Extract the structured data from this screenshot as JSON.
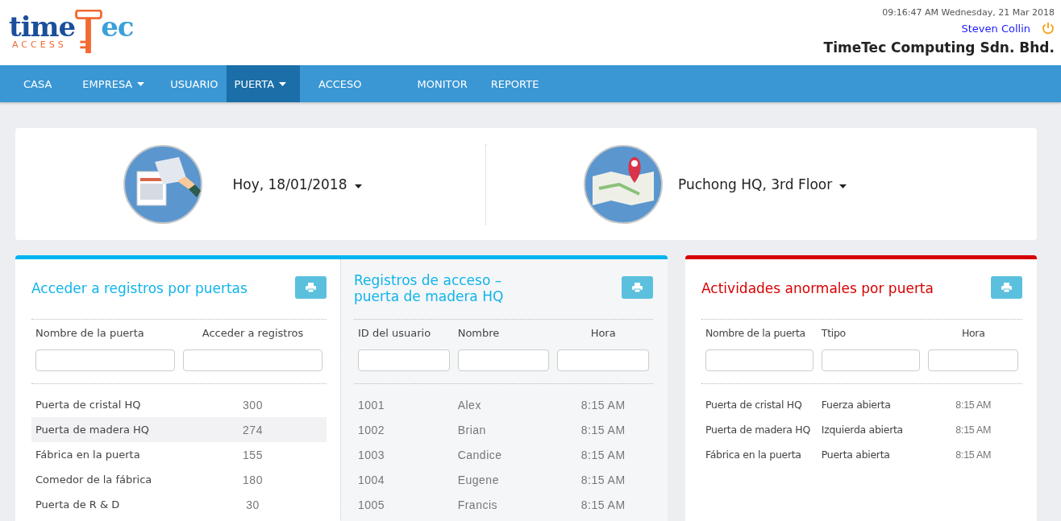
{
  "logo": {
    "word_left": "time",
    "word_right": "ec",
    "subtitle": "ACCESS"
  },
  "header": {
    "datetime": "09:16:47 AM Wednesday, 21 Mar 2018",
    "user": "Steven Collin",
    "company": "TimeTec Computing Sdn. Bhd."
  },
  "nav": [
    {
      "label": "CASA",
      "dropdown": false,
      "selected": false
    },
    {
      "label": "EMPRESA",
      "dropdown": true,
      "selected": false
    },
    {
      "label": "USUARIO",
      "dropdown": false,
      "selected": false
    },
    {
      "label": "PUERTA",
      "dropdown": true,
      "selected": true
    },
    {
      "label": "ACCESO",
      "dropdown": false,
      "selected": false
    },
    {
      "label": "MONITOR",
      "dropdown": false,
      "selected": false
    },
    {
      "label": "REPORTE",
      "dropdown": false,
      "selected": false
    }
  ],
  "filters": {
    "date": "Hoy, 18/01/2018",
    "location": "Puchong HQ, 3rd Floor"
  },
  "door_logs": {
    "title": "Acceder a registros por puertas",
    "columns": [
      "Nombre de la puerta",
      "Acceder a registros"
    ],
    "rows": [
      {
        "cells": [
          "Puerta de cristal HQ",
          "300"
        ],
        "selected": false
      },
      {
        "cells": [
          "Puerta de madera HQ",
          "274"
        ],
        "selected": true
      },
      {
        "cells": [
          "Fábrica en la puerta",
          "155"
        ],
        "selected": false
      },
      {
        "cells": [
          "Comedor de la fábrica",
          "180"
        ],
        "selected": false
      },
      {
        "cells": [
          "Puerta de R & D",
          "30"
        ],
        "selected": false
      }
    ]
  },
  "access_logs": {
    "title_line_1": "Registros de acceso –",
    "title_line_2": "puerta de madera HQ",
    "columns": [
      "ID del usuario",
      "Nombre",
      "Hora"
    ],
    "rows": [
      [
        "1001",
        "Alex",
        "8:15 AM"
      ],
      [
        "1002",
        "Brian",
        "8:15 AM"
      ],
      [
        "1003",
        "Candice",
        "8:15 AM"
      ],
      [
        "1004",
        "Eugene",
        "8:15 AM"
      ],
      [
        "1005",
        "Francis",
        "8:15 AM"
      ]
    ]
  },
  "abnormal": {
    "title": "Actividades anormales  por puerta",
    "columns": [
      "Nombre de la puerta",
      "Ttipo",
      "Hora"
    ],
    "rows": [
      [
        "Puerta de cristal HQ",
        "Fuerza abierta",
        "8:15 AM"
      ],
      [
        "Puerta de madera HQ",
        "Izquierda abierta",
        "8:15 AM"
      ],
      [
        "Fábrica en la puerta",
        "Puerta abierta",
        "8:15 AM"
      ]
    ]
  }
}
